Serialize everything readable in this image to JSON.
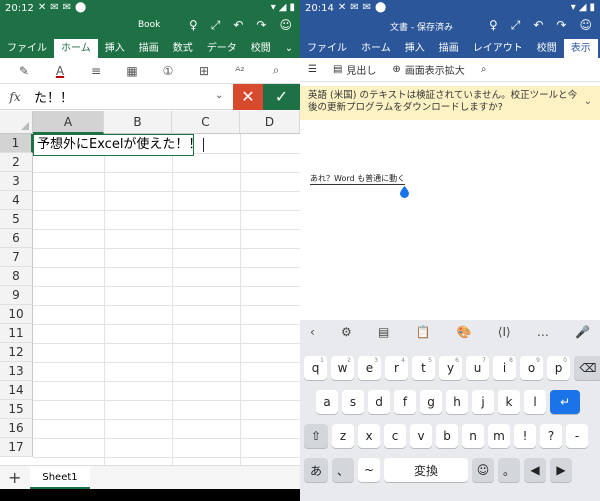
{
  "excel": {
    "status": {
      "time": "20:12",
      "icons": [
        "✕",
        "✉",
        "✉",
        "⬤"
      ],
      "right": [
        "▾",
        "◢",
        "▮"
      ]
    },
    "title": "Book",
    "title_icons": [
      "♀",
      "⤢",
      "↶",
      "↷",
      "☺"
    ],
    "tabs": [
      "ファイル",
      "ホーム",
      "挿入",
      "描画",
      "数式",
      "データ",
      "校閲"
    ],
    "tabs_more": "⌄",
    "toolbar_icons": [
      "✎",
      "A",
      "≡",
      "▦",
      "①",
      "⊞",
      "ᴬᶻ",
      "⌕"
    ],
    "font_color_bar": "#c00000",
    "formula": {
      "fx": "fx",
      "text": "た！！",
      "dropdown": "⌄",
      "cancel": "✕",
      "ok": "✓"
    },
    "columns": [
      "A",
      "B",
      "C",
      "D"
    ],
    "rows": [
      "1",
      "2",
      "3",
      "4",
      "5",
      "6",
      "7",
      "8",
      "9",
      "10",
      "11",
      "12",
      "13",
      "14",
      "15",
      "16",
      "17"
    ],
    "cell_a1": "予想外にExcelが使えた！！",
    "sheet_add": "+",
    "sheet_tab": "Sheet1",
    "accent": "#1e7145"
  },
  "word": {
    "status": {
      "time": "20:14",
      "icons": [
        "✕",
        "✉",
        "✉",
        "⬤"
      ],
      "right": [
        "▾",
        "◢",
        "▮"
      ]
    },
    "title": "文書 - 保存済み",
    "title_icons": [
      "♀",
      "⤢",
      "↶",
      "↷",
      "☺"
    ],
    "tabs": [
      "ファイル",
      "ホーム",
      "挿入",
      "描画",
      "レイアウト",
      "校閲",
      "表示"
    ],
    "toolbar": {
      "menu_icon": "☰",
      "heading_label": "見出し",
      "zoom_label": "画面表示拡大",
      "search_icon": "⌕"
    },
    "banner": {
      "text": "英語 (米国) のテキストは検証されていません。校正ツールと今後の更新プログラムをダウンロードしますか?",
      "close": "⌄"
    },
    "doc_text": "あれ？Word も普通に動く",
    "kb_toolbar": [
      "‹",
      "⚙",
      "▤",
      "📋",
      "🎨",
      "⟨I⟩",
      "…",
      "🎤"
    ],
    "kb_row1": [
      "q",
      "w",
      "e",
      "r",
      "t",
      "y",
      "u",
      "i",
      "o",
      "p"
    ],
    "kb_row1_sup": [
      "1",
      "2",
      "3",
      "4",
      "5",
      "6",
      "7",
      "8",
      "9",
      "0"
    ],
    "kb_row1_back": "⌫",
    "kb_row2": [
      "a",
      "s",
      "d",
      "f",
      "g",
      "h",
      "j",
      "k",
      "l"
    ],
    "kb_row2_enter": "↵",
    "kb_row3_shift": "⇧",
    "kb_row3": [
      "z",
      "x",
      "c",
      "v",
      "b",
      "n",
      "m",
      "!",
      "?",
      "-"
    ],
    "kb_row4": [
      "あ",
      "、",
      "~",
      "変換",
      "☺",
      "。",
      "◀",
      "▶"
    ],
    "accent": "#2b579a"
  }
}
